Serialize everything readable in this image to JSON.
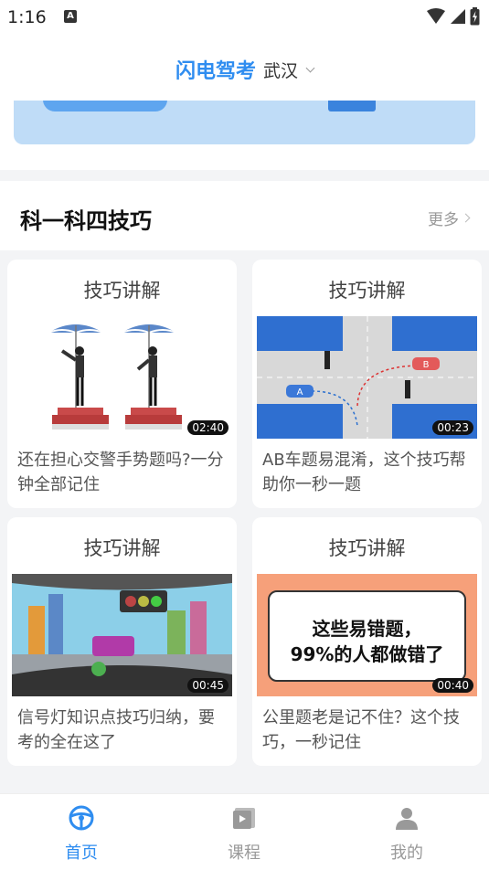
{
  "status": {
    "time": "1:16",
    "notif": "A"
  },
  "header": {
    "title": "闪电驾考",
    "city": "武汉"
  },
  "section": {
    "title": "科一科四技巧",
    "more": "更多"
  },
  "cards": [
    {
      "tag": "技巧讲解",
      "duration": "02:40",
      "title": "还在担心交警手势题吗?一分钟全部记住"
    },
    {
      "tag": "技巧讲解",
      "duration": "00:23",
      "title": "AB车题易混淆，这个技巧帮助你一秒一题"
    },
    {
      "tag": "技巧讲解",
      "duration": "00:45",
      "title": "信号灯知识点技巧归纳，要考的全在这了"
    },
    {
      "tag": "技巧讲解",
      "duration": "00:40",
      "title": "公里题老是记不住？这个技巧，一秒记住"
    }
  ],
  "thumb_text": {
    "car_a": "A",
    "car_b": "B",
    "poster_line1": "这些易错题，",
    "poster_line2": "99%的人都做错了"
  },
  "tabs": [
    {
      "label": "首页",
      "icon": "steering-wheel-icon",
      "active": true
    },
    {
      "label": "课程",
      "icon": "course-book-icon",
      "active": false
    },
    {
      "label": "我的",
      "icon": "user-icon",
      "active": false
    }
  ],
  "colors": {
    "accent": "#2f8df0",
    "inactive": "#999999",
    "banner": "#bfdcf7"
  }
}
